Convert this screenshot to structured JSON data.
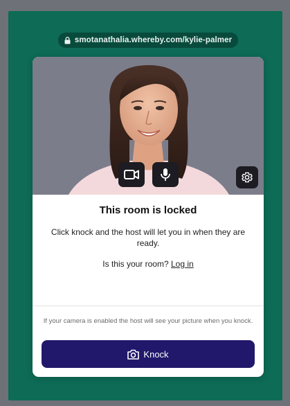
{
  "browser": {
    "url": "smotanathalia.whereby.com/kylie-palmer"
  },
  "room": {
    "title": "This room is locked",
    "description": "Click knock and the host will let you in when they are ready.",
    "own_room_question": "Is this your room?",
    "login_link": "Log in",
    "camera_note": "If your camera is enabled the host will see your picture when you knock.",
    "knock_button": "Knock"
  },
  "icons": {
    "url_lock": "lock-icon",
    "camera": "video-camera-icon",
    "microphone": "microphone-icon",
    "settings": "gear-icon",
    "knock": "camera-icon"
  },
  "colors": {
    "background": "#0d6b56",
    "url_pill": "#084a3c",
    "knock_button": "#21186b",
    "video_bg": "#7c7d8a"
  }
}
